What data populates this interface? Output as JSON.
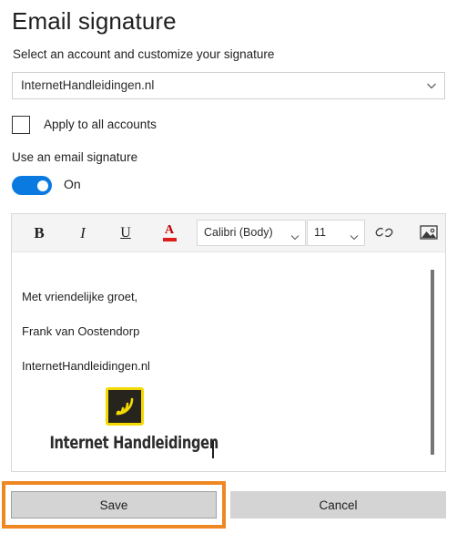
{
  "page": {
    "title": "Email signature",
    "subtitle": "Select an account and customize your signature"
  },
  "account_select": {
    "value": "InternetHandleidingen.nl",
    "chevron_icon": "chevron-down-icon"
  },
  "apply_all": {
    "label": "Apply to all accounts",
    "checked": false
  },
  "use_signature": {
    "caption": "Use an email signature",
    "state_label": "On",
    "on": true,
    "accent_color": "#0a7ae0"
  },
  "toolbar": {
    "bold_label": "B",
    "italic_label": "I",
    "underline_label": "U",
    "font_color_label": "A",
    "font_color_swatch": "#e01b1b",
    "font_family": "Calibri (Body)",
    "font_size": "11",
    "link_icon": "link-icon",
    "image_icon": "picture-icon"
  },
  "signature": {
    "lines": [
      "Met vriendelijke groet,",
      "Frank van Oostendorp",
      "InternetHandleidingen.nl"
    ],
    "logo_wordmark": "Internet Handleidingen",
    "logo_icon": "rss-signal-icon",
    "logo_background": "#27241d",
    "logo_accent": "#f3d900"
  },
  "footer": {
    "save_label": "Save",
    "cancel_label": "Cancel",
    "highlight_color": "#ef8822"
  }
}
